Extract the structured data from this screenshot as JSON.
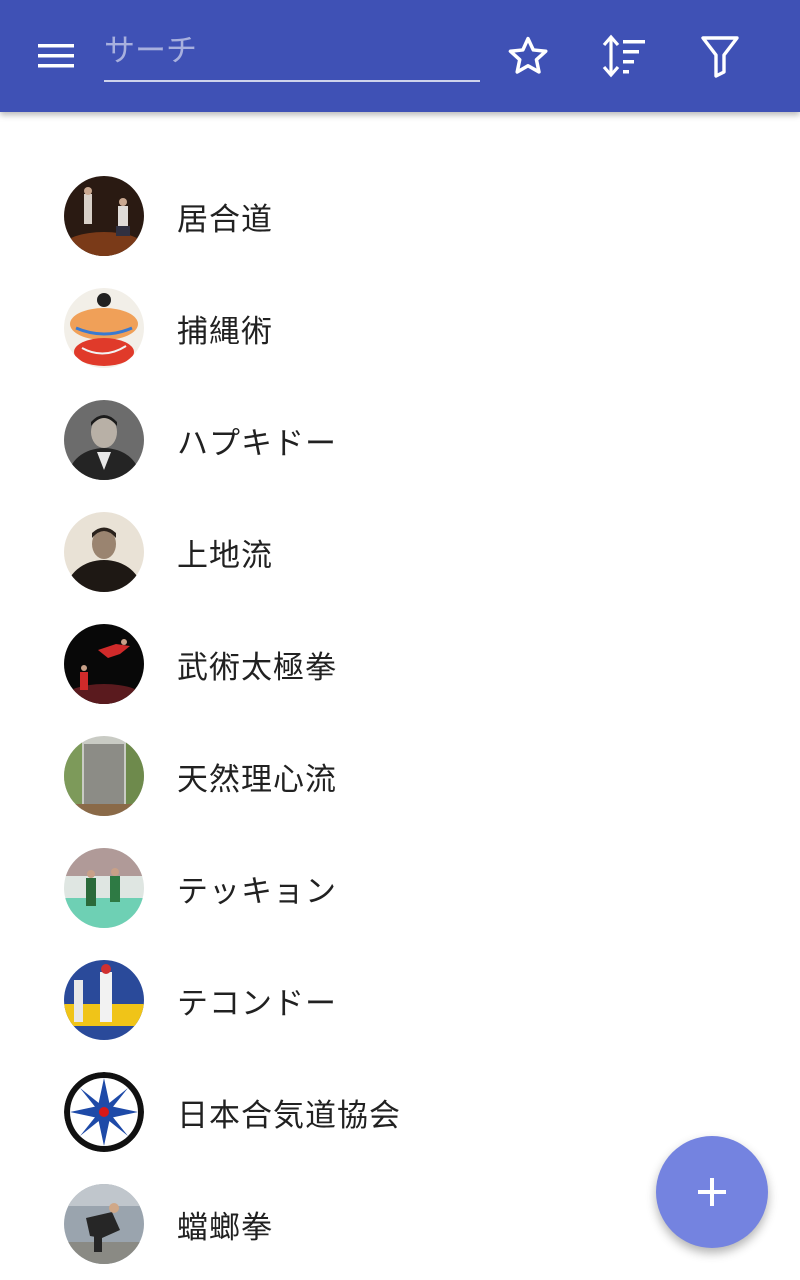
{
  "colors": {
    "appbar": "#3f51b5",
    "fab": "#7483e0",
    "text": "#212121"
  },
  "toolbar": {
    "menu_icon": "menu-icon",
    "search_placeholder": "サーチ",
    "search_value": "",
    "actions": [
      {
        "icon": "star-outline-icon"
      },
      {
        "icon": "sort-icon"
      },
      {
        "icon": "filter-icon"
      }
    ]
  },
  "list": {
    "items": [
      {
        "label": "居合道",
        "avatar": "iaido-photo"
      },
      {
        "label": "捕縄術",
        "avatar": "hojojutsu-illustration"
      },
      {
        "label": "ハプキドー",
        "avatar": "hapkido-portrait"
      },
      {
        "label": "上地流",
        "avatar": "uechi-ryu-portrait"
      },
      {
        "label": "武術太極拳",
        "avatar": "wushu-photo"
      },
      {
        "label": "天然理心流",
        "avatar": "tennen-rishin-ryu-monument"
      },
      {
        "label": "テッキョン",
        "avatar": "taekkyon-photo"
      },
      {
        "label": "テコンドー",
        "avatar": "taekwondo-photo"
      },
      {
        "label": "日本合気道協会",
        "avatar": "aikido-association-logo"
      },
      {
        "label": "蟷螂拳",
        "avatar": "mantis-boxing-photo"
      }
    ]
  },
  "fab": {
    "icon": "plus-icon"
  }
}
